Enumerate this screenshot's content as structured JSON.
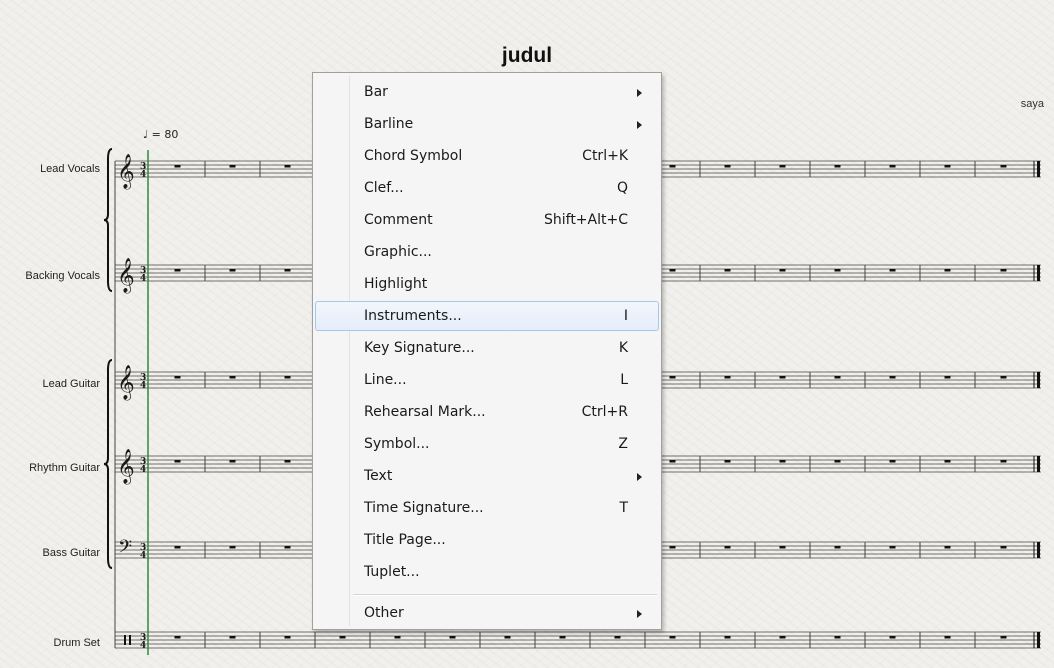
{
  "score": {
    "title": "judul",
    "composer": "saya",
    "tempo": "♩ = 80",
    "instruments": [
      {
        "name": "Lead Vocals",
        "clef": "treble"
      },
      {
        "name": "Backing Vocals",
        "clef": "treble"
      },
      {
        "name": "Lead Guitar",
        "clef": "treble"
      },
      {
        "name": "Rhythm Guitar",
        "clef": "treble"
      },
      {
        "name": "Bass Guitar",
        "clef": "bass"
      },
      {
        "name": "Drum Set",
        "clef": "percussion"
      }
    ],
    "time_signature": "3/4"
  },
  "context_menu": {
    "items": [
      {
        "label": "Bar",
        "shortcut": "",
        "submenu": true
      },
      {
        "label": "Barline",
        "shortcut": "",
        "submenu": true
      },
      {
        "label": "Chord Symbol",
        "shortcut": "Ctrl+K",
        "submenu": false
      },
      {
        "label": "Clef...",
        "shortcut": "Q",
        "submenu": false
      },
      {
        "label": "Comment",
        "shortcut": "Shift+Alt+C",
        "submenu": false
      },
      {
        "label": "Graphic...",
        "shortcut": "",
        "submenu": false
      },
      {
        "label": "Highlight",
        "shortcut": "",
        "submenu": false
      },
      {
        "label": "Instruments...",
        "shortcut": "I",
        "submenu": false,
        "highlighted": true
      },
      {
        "label": "Key Signature...",
        "shortcut": "K",
        "submenu": false
      },
      {
        "label": "Line...",
        "shortcut": "L",
        "submenu": false
      },
      {
        "label": "Rehearsal Mark...",
        "shortcut": "Ctrl+R",
        "submenu": false
      },
      {
        "label": "Symbol...",
        "shortcut": "Z",
        "submenu": false
      },
      {
        "label": "Text",
        "shortcut": "",
        "submenu": true
      },
      {
        "label": "Time Signature...",
        "shortcut": "T",
        "submenu": false
      },
      {
        "label": "Title Page...",
        "shortcut": "",
        "submenu": false
      },
      {
        "label": "Tuplet...",
        "shortcut": "",
        "submenu": false
      },
      {
        "label": "Other",
        "shortcut": "",
        "submenu": true
      }
    ]
  },
  "colors": {
    "paper": "#f2f0ec",
    "staff_line": "#444444",
    "playback_line": "#2e8b3a",
    "menu_highlight_border": "#a8c8ea"
  },
  "icons": {
    "submenu": "submenu-arrow-icon"
  }
}
